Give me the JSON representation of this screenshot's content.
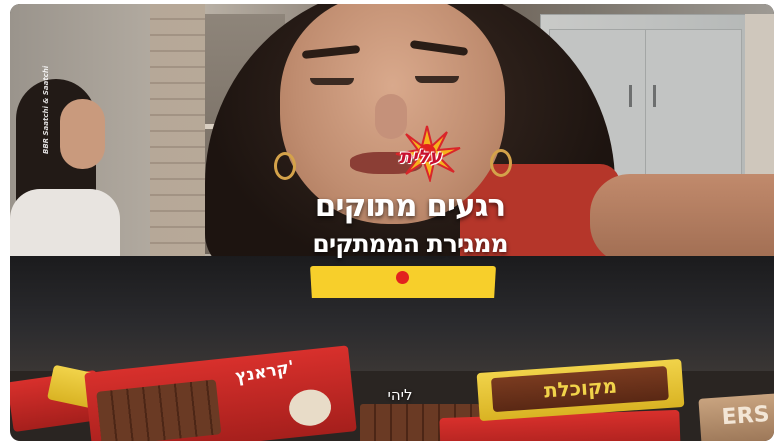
{
  "video": {
    "watermark": "BBR Saatchi & Saatchi",
    "brand_logo": "עלית",
    "headline_line1": "רגעים מתוקים",
    "headline_line2": "ממגירת הממתקים",
    "caption": "ליהי"
  },
  "products": {
    "bar_left_label": "קראנץ'",
    "bar_right_label": "מקוכלת",
    "bar_far_right_label": "ERS"
  },
  "colors": {
    "logo_red": "#c8102e",
    "banner_yellow": "#f7cf2b",
    "dot_red": "#e2221e"
  }
}
